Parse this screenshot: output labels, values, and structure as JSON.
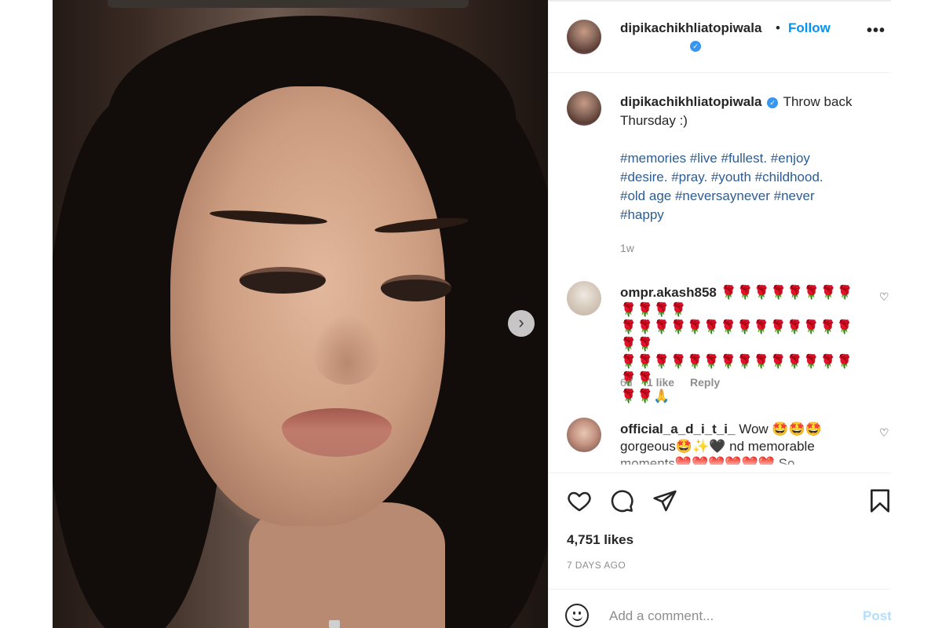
{
  "post": {
    "owner": "dipikachikhliatopiwala",
    "follow_label": "Follow",
    "separator": "•",
    "more_label": "•••",
    "next_arrow": "›",
    "caption_text": "Throw back Thursday :)",
    "hashtag_lines": [
      "#memories #live #fullest. #enjoy",
      "#desire. #pray. #youth #childhood.",
      "#old age #neversaynever #never",
      "#happy"
    ],
    "caption_time": "1w",
    "likes": "4,751 likes",
    "date": "7 DAYS AGO",
    "add_comment_placeholder": "Add a comment...",
    "post_label": "Post"
  },
  "comments": [
    {
      "username": "ompr.akash858",
      "text_line1": "🌹🌹🌹🌹🌹🌹🌹🌹🌹🌹🌹🌹",
      "text_line2": "🌹🌹🌹🌹🌹🌹🌹🌹🌹🌹🌹🌹🌹🌹🌹🌹",
      "text_line3": "🌹🌹🌹🌹🌹🌹🌹🌹🌹🌹🌹🌹🌹🌹🌹🌹",
      "text_line4": "🌹🌹🙏",
      "time": "6d",
      "likes": "1 like",
      "reply": "Reply"
    },
    {
      "username": "official_a_d_i_t_i_",
      "text_line1": "Wow 🤩🤩🤩",
      "text_line2": "gorgeous🤩✨🖤 nd memorable",
      "text_line3": "moments❤️❤️❤️❤️❤️❤️ So"
    }
  ],
  "icons": {
    "heart": "heart-icon",
    "comment": "comment-icon",
    "share": "share-icon",
    "save": "bookmark-icon",
    "emoji": "smiley-icon"
  },
  "colors": {
    "accent": "#0095f6",
    "hashtag": "#00376b",
    "muted": "#8e8e8e",
    "post_disabled": "#b2dffc"
  }
}
